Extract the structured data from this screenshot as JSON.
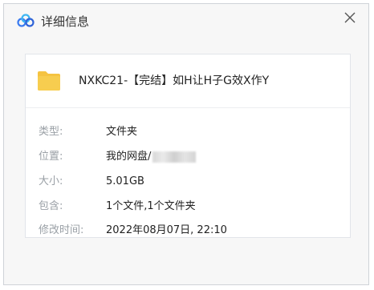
{
  "window": {
    "title": "详细信息",
    "logo_icon": "cloud-logo-icon",
    "close_icon": "close-icon"
  },
  "file": {
    "icon": "folder-icon",
    "name": "NXKC21-【完结】如H让H子G效X作Y"
  },
  "details": [
    {
      "label": "类型:",
      "value": "文件夹"
    },
    {
      "label": "位置:",
      "value": "我的网盘/"
    },
    {
      "label": "大小:",
      "value": "5.01GB"
    },
    {
      "label": "包含:",
      "value": "1个文件,1个文件夹"
    },
    {
      "label": "修改时间:",
      "value": "2022年08月07日, 22:10"
    }
  ],
  "colors": {
    "label": "#9aa0a6",
    "folder": "#f5c341",
    "logo_blue": "#3a7bf0"
  }
}
